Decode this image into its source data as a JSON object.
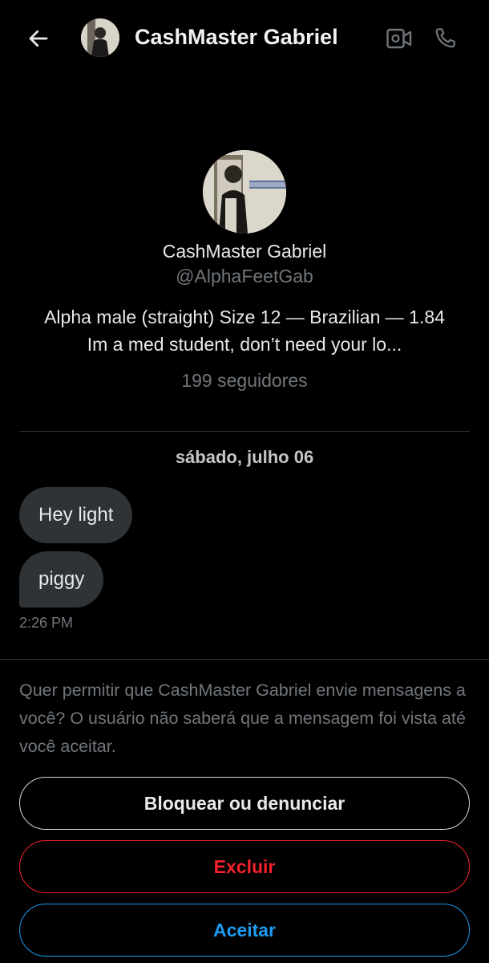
{
  "header": {
    "title": "CashMaster Gabriel",
    "back_icon": "arrow-left-icon",
    "video_icon": "video-camera-icon",
    "phone_icon": "phone-icon"
  },
  "profile": {
    "name": "CashMaster Gabriel",
    "handle": "@AlphaFeetGab",
    "bio": "Alpha male (straight) Size 12 — Brazilian — 1.84 Im a med student, don’t need your lo...",
    "followers": "199 seguidores"
  },
  "conversation": {
    "date": "sábado, julho 06",
    "messages": [
      {
        "text": "Hey light"
      },
      {
        "text": "piggy"
      }
    ],
    "time": "2:26 PM"
  },
  "request": {
    "text": "Quer permitir que CashMaster Gabriel envie mensagens a você? O usuário não saberá que a mensagem foi vista até você aceitar.",
    "block_label": "Bloquear ou denunciar",
    "delete_label": "Excluir",
    "accept_label": "Aceitar"
  },
  "colors": {
    "background": "#000000",
    "bubble": "#2f3336",
    "muted": "#71767b",
    "danger": "#f4212e",
    "accent": "#1d9bf0"
  }
}
